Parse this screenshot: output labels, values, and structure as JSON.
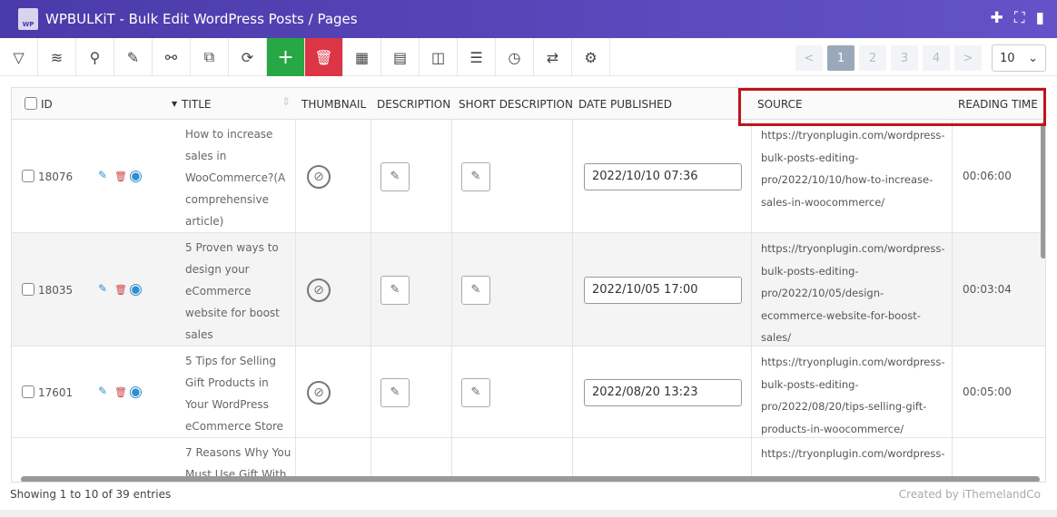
{
  "app": {
    "title": "WPBULKiT - Bulk Edit WordPress Posts / Pages",
    "logo_text": "WP"
  },
  "pager": {
    "prev": "<",
    "pages": [
      "1",
      "2",
      "3",
      "4"
    ],
    "next": ">",
    "per_page": "10"
  },
  "columns": {
    "id": "ID",
    "title": "TITLE",
    "thumbnail": "THUMBNAIL",
    "description": "DESCRIPTION",
    "short_description": "SHORT DESCRIPTION",
    "date_published": "DATE PUBLISHED",
    "source": "SOURCE",
    "reading_time": "READING TIME"
  },
  "rows": [
    {
      "id": "18076",
      "title": [
        "How to increase",
        "sales in",
        "WooCommerce?(A",
        "comprehensive",
        "article)"
      ],
      "date": "2022/10/10 07:36",
      "source": [
        "https://tryonplugin.com/wordpress-",
        "bulk-posts-editing-",
        "pro/2022/10/10/how-to-increase-",
        "sales-in-woocommerce/"
      ],
      "reading_time": "00:06:00"
    },
    {
      "id": "18035",
      "title": [
        "5 Proven ways to",
        "design your",
        "eCommerce",
        "website for boost",
        "sales"
      ],
      "date": "2022/10/05 17:00",
      "source": [
        "https://tryonplugin.com/wordpress-",
        "bulk-posts-editing-",
        "pro/2022/10/05/design-",
        "ecommerce-website-for-boost-",
        "sales/"
      ],
      "reading_time": "00:03:04"
    },
    {
      "id": "17601",
      "title": [
        "5 Tips for Selling",
        "Gift Products in",
        "Your WordPress",
        "eCommerce Store"
      ],
      "date": "2022/08/20 13:23",
      "source": [
        "https://tryonplugin.com/wordpress-",
        "bulk-posts-editing-",
        "pro/2022/08/20/tips-selling-gift-",
        "products-in-woocommerce/"
      ],
      "reading_time": "00:05:00"
    },
    {
      "id": "",
      "title": [
        "7 Reasons Why You",
        "Must Use Gift With"
      ],
      "date": "",
      "source": [
        "https://tryonplugin.com/wordpress-"
      ],
      "reading_time": ""
    }
  ],
  "footer": {
    "showing": "Showing 1 to 10 of 39 entries",
    "credit": "Created by iThemelandCo"
  }
}
